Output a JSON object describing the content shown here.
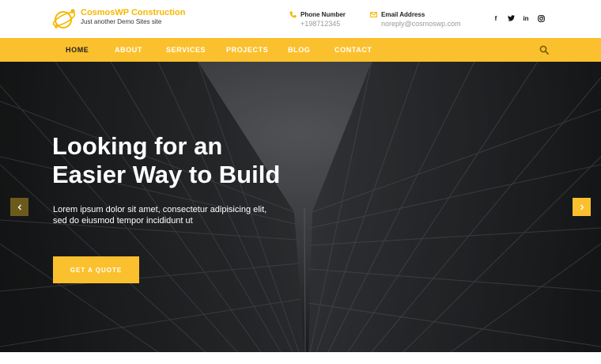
{
  "site": {
    "title": "CosmosWP Construction",
    "tagline": "Just another Demo Sites site"
  },
  "contact": {
    "phone_label": "Phone Number",
    "phone_value": "+198712345",
    "email_label": "Email Address",
    "email_value": "noreply@cosmoswp.com"
  },
  "social": {
    "facebook": "f",
    "twitter": "twitter-icon",
    "linkedin": "in",
    "instagram": "instagram-icon"
  },
  "nav": {
    "items": [
      {
        "label": "HOME",
        "active": true
      },
      {
        "label": "ABOUT"
      },
      {
        "label": "SERVICES"
      },
      {
        "label": "PROJECTS"
      },
      {
        "label": "BLOG"
      },
      {
        "label": "CONTACT"
      }
    ],
    "search_icon": "search-icon"
  },
  "hero": {
    "title_line1": "Looking for an",
    "title_line2": "Easier Way to Build",
    "text_line1": "Lorem ipsum dolor sit amet, consectetur adipisicing elit,",
    "text_line2": "sed do eiusmod tempor incididunt ut",
    "cta_label": "GET A QUOTE",
    "prev_icon": "chevron-left-icon",
    "next_icon": "chevron-right-icon"
  },
  "colors": {
    "accent": "#fbc02d",
    "brand_text": "#f5b800",
    "dark": "#222222",
    "hero_bg": "#2a2b2d"
  }
}
